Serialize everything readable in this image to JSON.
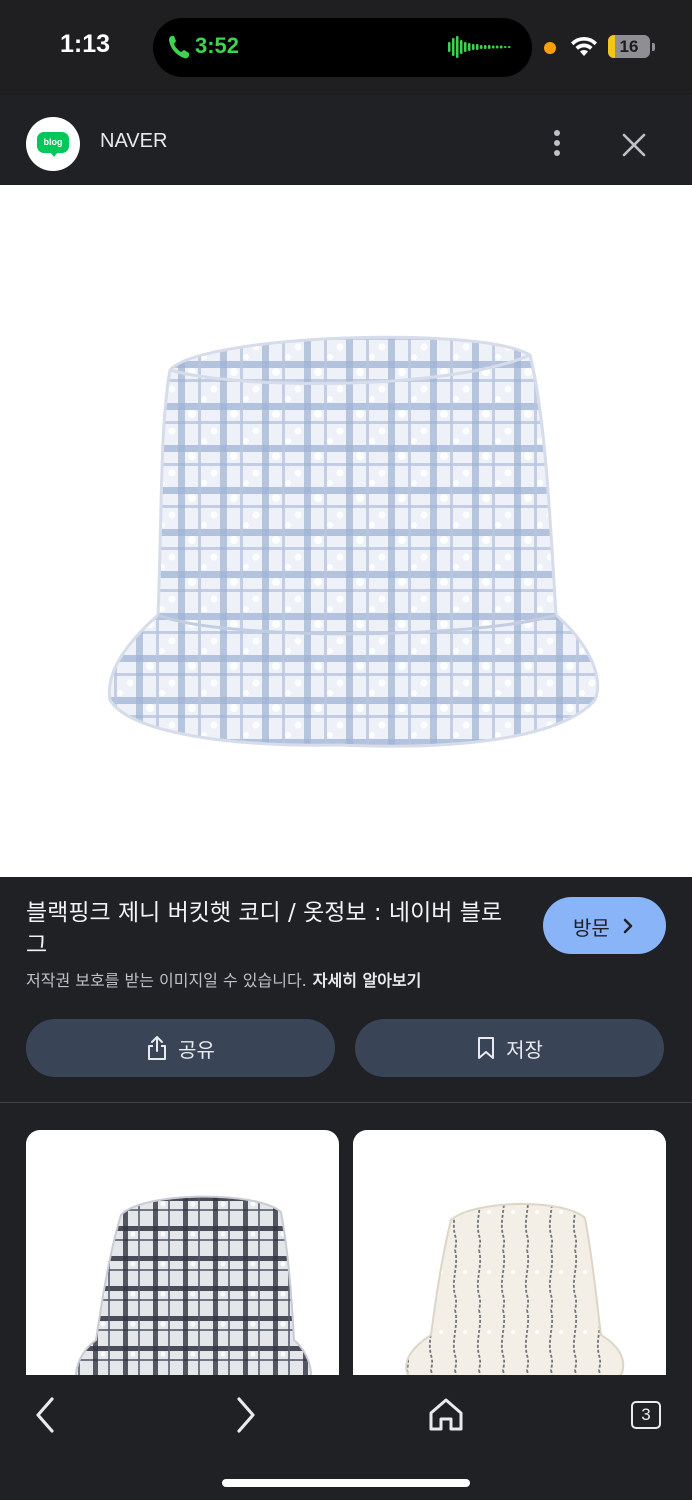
{
  "status_bar": {
    "time": "1:13",
    "call_duration": "3:52",
    "battery_level": "16",
    "battery_fraction": 0.16,
    "call_color": "#3fd24f",
    "battery_color": "#f5c518"
  },
  "header": {
    "logo_text": "blog",
    "site_name": "NAVER",
    "more_icon": "more-vert-icon",
    "close_icon": "close-icon"
  },
  "result": {
    "title": "블랙핑크 제니 버킷햇 코디 / 옷정보 : 네이버 블로그",
    "visit_label": "방문",
    "copyright_notice": "저작권 보호를 받는 이미지일 수 있습니다.",
    "learn_more": "자세히 알아보기",
    "share_label": "공유",
    "save_label": "저장",
    "accent_color": "#8ab4f8"
  },
  "bottom_nav": {
    "tab_count": "3"
  }
}
